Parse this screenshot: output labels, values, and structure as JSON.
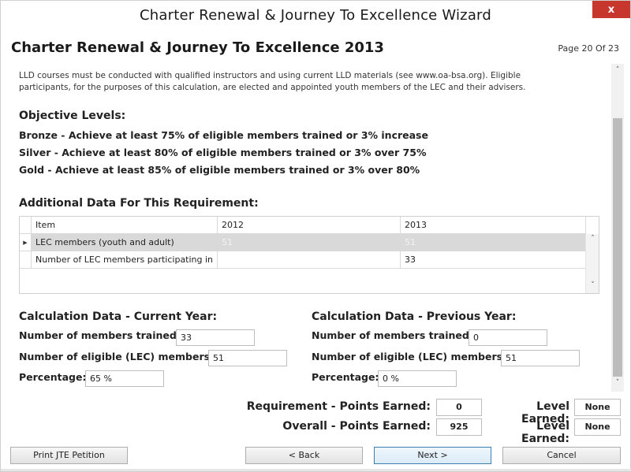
{
  "window": {
    "title": "Charter Renewal & Journey To Excellence Wizard",
    "close_glyph": "x"
  },
  "header": {
    "heading": "Charter Renewal & Journey To Excellence 2013",
    "page_counter": "Page 20 Of 23"
  },
  "intro_text": "LLD courses must be conducted with qualified instructors and using current LLD materials (see www.oa-bsa.org). Eligible participants, for the purposes of this calculation, are elected and appointed youth members of the LEC and their advisers.",
  "objectives": {
    "title": "Objective Levels:",
    "levels": [
      "Bronze - Achieve at least 75% of eligible members trained or 3% increase",
      "Silver - Achieve at least 80% of eligible members trained or 3% over 75%",
      "Gold - Achieve at least 85% of eligible members trained or 3% over 80%"
    ]
  },
  "additional": {
    "title": "Additional Data For This Requirement:",
    "columns": [
      "Item",
      "2012",
      "2013"
    ],
    "rows": [
      {
        "item": "LEC members (youth and adult)",
        "y2012": "51",
        "y2013": "51",
        "marker": "▶"
      },
      {
        "item": "Number of LEC members participating in",
        "y2012": "",
        "y2013": "33",
        "marker": ""
      }
    ]
  },
  "current_year": {
    "title": "Calculation Data - Current Year:",
    "trained_label": "Number of members trained:",
    "trained_value": "33",
    "eligible_label": "Number of eligible (LEC) members:",
    "eligible_value": "51",
    "percentage_label": "Percentage:",
    "percentage_value": "65 %"
  },
  "previous_year": {
    "title": "Calculation Data - Previous Year:",
    "trained_label": "Number of members trained:",
    "trained_value": "0",
    "eligible_label": "Number of eligible (LEC) members:",
    "eligible_value": "51",
    "percentage_label": "Percentage:",
    "percentage_value": "0 %"
  },
  "points": {
    "requirement_label": "Requirement - Points Earned:",
    "requirement_value": "0",
    "requirement_level_label": "Level Earned:",
    "requirement_level_value": "None",
    "overall_label": "Overall - Points Earned:",
    "overall_value": "925",
    "overall_level_label": "Level Earned:",
    "overall_level_value": "None"
  },
  "buttons": {
    "print": "Print JTE Petition",
    "back": "< Back",
    "next": "Next >",
    "cancel": "Cancel"
  },
  "icons": {
    "scroll_up": "˄",
    "scroll_down": "˅"
  }
}
